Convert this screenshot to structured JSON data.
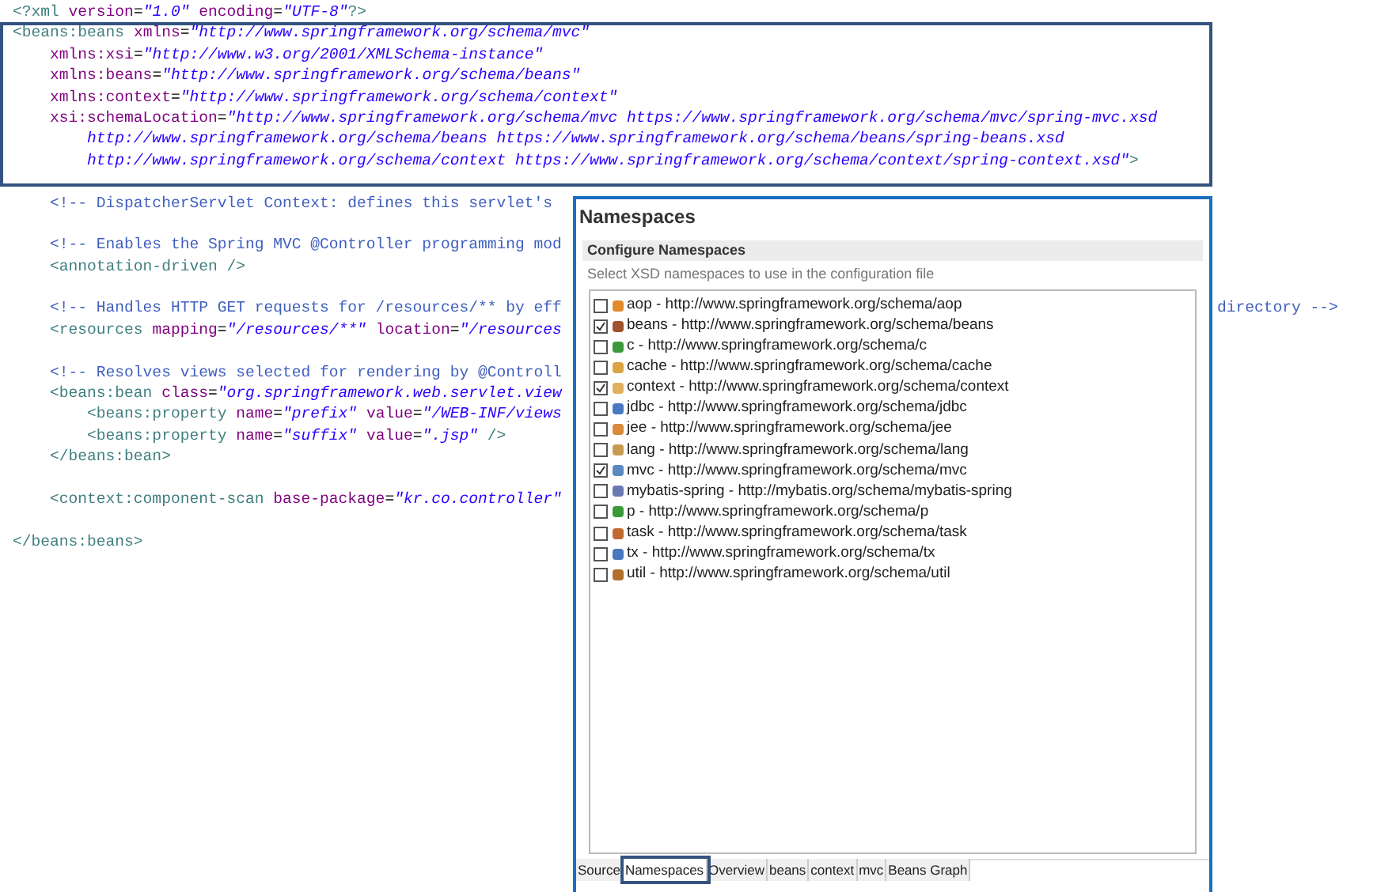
{
  "editor": {
    "lines": [
      {
        "kind": "code",
        "tokens": [
          {
            "kind": "tag",
            "text": "<?xml"
          },
          {
            "kind": "attr",
            "text": " version"
          },
          {
            "kind": "punct",
            "text": "="
          },
          {
            "kind": "value",
            "text": "\"1.0\""
          },
          {
            "kind": "attr",
            "text": " encoding"
          },
          {
            "kind": "punct",
            "text": "="
          },
          {
            "kind": "value",
            "text": "\"UTF-8\""
          },
          {
            "kind": "tag",
            "text": "?>"
          }
        ]
      },
      {
        "kind": "code",
        "tokens": [
          {
            "kind": "tag",
            "text": "<beans:beans"
          },
          {
            "kind": "attr",
            "text": " xmlns"
          },
          {
            "kind": "punct",
            "text": "="
          },
          {
            "kind": "value",
            "text": "\"http://www.springframework.org/schema/mvc\""
          }
        ]
      },
      {
        "kind": "code",
        "tokens": [
          {
            "kind": "attr",
            "text": "    xmlns:xsi"
          },
          {
            "kind": "punct",
            "text": "="
          },
          {
            "kind": "value",
            "text": "\"http://www.w3.org/2001/XMLSchema-instance\""
          }
        ]
      },
      {
        "kind": "code",
        "tokens": [
          {
            "kind": "attr",
            "text": "    xmlns:beans"
          },
          {
            "kind": "punct",
            "text": "="
          },
          {
            "kind": "value",
            "text": "\"http://www.springframework.org/schema/beans\""
          }
        ]
      },
      {
        "kind": "code",
        "tokens": [
          {
            "kind": "attr",
            "text": "    xmlns:context"
          },
          {
            "kind": "punct",
            "text": "="
          },
          {
            "kind": "value",
            "text": "\"http://www.springframework.org/schema/context\""
          }
        ]
      },
      {
        "kind": "code",
        "tokens": [
          {
            "kind": "attr",
            "text": "    xsi:schemaLocation"
          },
          {
            "kind": "punct",
            "text": "="
          },
          {
            "kind": "value",
            "text": "\"http://www.springframework.org/schema/mvc https://www.springframework.org/schema/mvc/spring-mvc.xsd"
          }
        ]
      },
      {
        "kind": "code",
        "tokens": [
          {
            "kind": "value",
            "text": "        http://www.springframework.org/schema/beans https://www.springframework.org/schema/beans/spring-beans.xsd"
          }
        ]
      },
      {
        "kind": "code",
        "tokens": [
          {
            "kind": "value",
            "text": "        http://www.springframework.org/schema/context https://www.springframework.org/schema/context/spring-context.xsd\""
          },
          {
            "kind": "tag",
            "text": ">"
          }
        ]
      },
      {
        "kind": "blank"
      },
      {
        "kind": "code",
        "tokens": [
          {
            "kind": "comment",
            "text": "    <!-- DispatcherServlet Context: defines this servlet's"
          }
        ]
      },
      {
        "kind": "blank"
      },
      {
        "kind": "code",
        "tokens": [
          {
            "kind": "comment",
            "text": "    <!-- Enables the Spring MVC @Controller programming mod"
          }
        ]
      },
      {
        "kind": "code",
        "tokens": [
          {
            "kind": "tag",
            "text": "    <annotation-driven />"
          }
        ]
      },
      {
        "kind": "blank"
      },
      {
        "kind": "code",
        "tokens": [
          {
            "kind": "comment",
            "text": "    <!-- Handles HTTP GET requests for /resources/** by eff"
          }
        ],
        "tail": "directory -->"
      },
      {
        "kind": "code",
        "tokens": [
          {
            "kind": "tag",
            "text": "    <resources"
          },
          {
            "kind": "attr",
            "text": " mapping"
          },
          {
            "kind": "punct",
            "text": "="
          },
          {
            "kind": "value",
            "text": "\"/resources/**\""
          },
          {
            "kind": "attr",
            "text": " location"
          },
          {
            "kind": "punct",
            "text": "="
          },
          {
            "kind": "value",
            "text": "\"/resources"
          }
        ]
      },
      {
        "kind": "blank"
      },
      {
        "kind": "code",
        "tokens": [
          {
            "kind": "comment",
            "text": "    <!-- Resolves views selected for rendering by @Controll"
          }
        ]
      },
      {
        "kind": "code",
        "tokens": [
          {
            "kind": "tag",
            "text": "    <beans:bean"
          },
          {
            "kind": "attr",
            "text": " class"
          },
          {
            "kind": "punct",
            "text": "="
          },
          {
            "kind": "value",
            "text": "\"org.springframework.web.servlet.view"
          }
        ]
      },
      {
        "kind": "code",
        "tokens": [
          {
            "kind": "tag",
            "text": "        <beans:property"
          },
          {
            "kind": "attr",
            "text": " name"
          },
          {
            "kind": "punct",
            "text": "="
          },
          {
            "kind": "value",
            "text": "\"prefix\""
          },
          {
            "kind": "attr",
            "text": " value"
          },
          {
            "kind": "punct",
            "text": "="
          },
          {
            "kind": "value",
            "text": "\"/WEB-INF/views"
          }
        ]
      },
      {
        "kind": "code",
        "tokens": [
          {
            "kind": "tag",
            "text": "        <beans:property"
          },
          {
            "kind": "attr",
            "text": " name"
          },
          {
            "kind": "punct",
            "text": "="
          },
          {
            "kind": "value",
            "text": "\"suffix\""
          },
          {
            "kind": "attr",
            "text": " value"
          },
          {
            "kind": "punct",
            "text": "="
          },
          {
            "kind": "value",
            "text": "\".jsp\""
          },
          {
            "kind": "tag",
            "text": " />"
          }
        ]
      },
      {
        "kind": "code",
        "tokens": [
          {
            "kind": "tag",
            "text": "    </beans:bean>"
          }
        ]
      },
      {
        "kind": "blank"
      },
      {
        "kind": "code",
        "tokens": [
          {
            "kind": "tag",
            "text": "    <context:component-scan"
          },
          {
            "kind": "attr",
            "text": " base-package"
          },
          {
            "kind": "punct",
            "text": "="
          },
          {
            "kind": "value",
            "text": "\"kr.co.controller\""
          }
        ]
      },
      {
        "kind": "blank"
      },
      {
        "kind": "code",
        "tokens": [
          {
            "kind": "tag",
            "text": "</beans:beans>"
          }
        ]
      }
    ]
  },
  "namespaces_panel": {
    "title": "Namespaces",
    "section": "Configure Namespaces",
    "description": "Select XSD namespaces to use in the configuration file",
    "items": [
      {
        "label": "aop - http://www.springframework.org/schema/aop",
        "checked": false,
        "color": "#e08a2c"
      },
      {
        "label": "beans - http://www.springframework.org/schema/beans",
        "checked": true,
        "color": "#a0522d"
      },
      {
        "label": "c - http://www.springframework.org/schema/c",
        "checked": false,
        "color": "#3a9a3a"
      },
      {
        "label": "cache - http://www.springframework.org/schema/cache",
        "checked": false,
        "color": "#d9a441"
      },
      {
        "label": "context - http://www.springframework.org/schema/context",
        "checked": true,
        "color": "#e0b060"
      },
      {
        "label": "jdbc - http://www.springframework.org/schema/jdbc",
        "checked": false,
        "color": "#4a78c0"
      },
      {
        "label": "jee - http://www.springframework.org/schema/jee",
        "checked": false,
        "color": "#d98a3a"
      },
      {
        "label": "lang - http://www.springframework.org/schema/lang",
        "checked": false,
        "color": "#c89a50"
      },
      {
        "label": "mvc - http://www.springframework.org/schema/mvc",
        "checked": true,
        "color": "#5a8ac0"
      },
      {
        "label": "mybatis-spring - http://mybatis.org/schema/mybatis-spring",
        "checked": false,
        "color": "#6a7ab0"
      },
      {
        "label": "p - http://www.springframework.org/schema/p",
        "checked": false,
        "color": "#3a9a3a"
      },
      {
        "label": "task - http://www.springframework.org/schema/task",
        "checked": false,
        "color": "#c06a30"
      },
      {
        "label": "tx - http://www.springframework.org/schema/tx",
        "checked": false,
        "color": "#4a78c0"
      },
      {
        "label": "util - http://www.springframework.org/schema/util",
        "checked": false,
        "color": "#b0702a"
      }
    ],
    "tabs": [
      {
        "label": "Source",
        "selected": false
      },
      {
        "label": "Namespaces",
        "selected": true
      },
      {
        "label": "Overview",
        "selected": false
      },
      {
        "label": "beans",
        "selected": false
      },
      {
        "label": "context",
        "selected": false
      },
      {
        "label": "mvc",
        "selected": false
      },
      {
        "label": "Beans Graph",
        "selected": false
      }
    ]
  }
}
